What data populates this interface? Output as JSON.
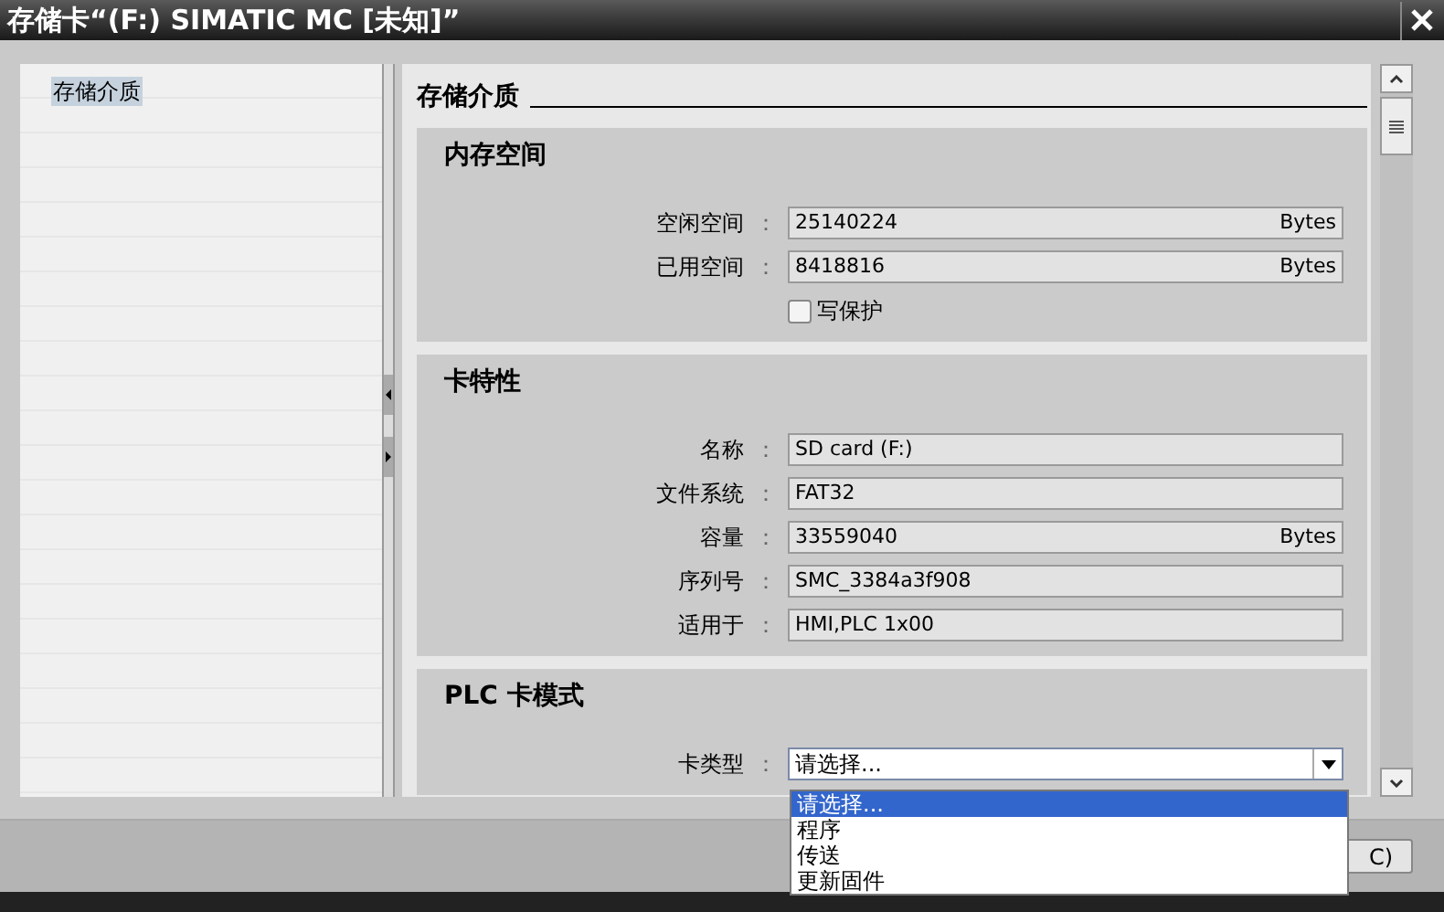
{
  "window": {
    "title": "存储卡“(F:) SIMATIC MC [未知]”"
  },
  "sidebar": {
    "items": [
      {
        "label": "存储介质",
        "selected": true
      }
    ]
  },
  "content": {
    "heading": "存储介质",
    "sections": [
      {
        "title": "内存空间",
        "rows": [
          {
            "kind": "field",
            "label": "空闲空间",
            "colon": "：",
            "value": "25140224",
            "unit": "Bytes"
          },
          {
            "kind": "field",
            "label": "已用空间",
            "colon": "：",
            "value": "8418816",
            "unit": "Bytes"
          },
          {
            "kind": "checkbox",
            "label": "写保护",
            "checked": false
          }
        ]
      },
      {
        "title": "卡特性",
        "rows": [
          {
            "kind": "field",
            "label": "名称",
            "colon": "：",
            "value": "SD card (F:)"
          },
          {
            "kind": "field",
            "label": "文件系统",
            "colon": "：",
            "value": "FAT32"
          },
          {
            "kind": "field",
            "label": "容量",
            "colon": "：",
            "value": "33559040",
            "unit": "Bytes"
          },
          {
            "kind": "field",
            "label": "序列号",
            "colon": "：",
            "value": "SMC_3384a3f908"
          },
          {
            "kind": "field",
            "label": "适用于",
            "colon": "：",
            "value": "HMI,PLC 1x00"
          }
        ]
      },
      {
        "title": "PLC 卡模式",
        "rows": [
          {
            "kind": "dropdown",
            "label": "卡类型",
            "colon": "：",
            "value": "请选择...",
            "expanded": true,
            "options": [
              {
                "label": "请选择...",
                "selected": true
              },
              {
                "label": "程序",
                "selected": false
              },
              {
                "label": "传送",
                "selected": false
              },
              {
                "label": "更新固件",
                "selected": false
              }
            ]
          }
        ]
      }
    ]
  },
  "footer": {
    "buttons": [
      {
        "label": "C)"
      }
    ]
  }
}
